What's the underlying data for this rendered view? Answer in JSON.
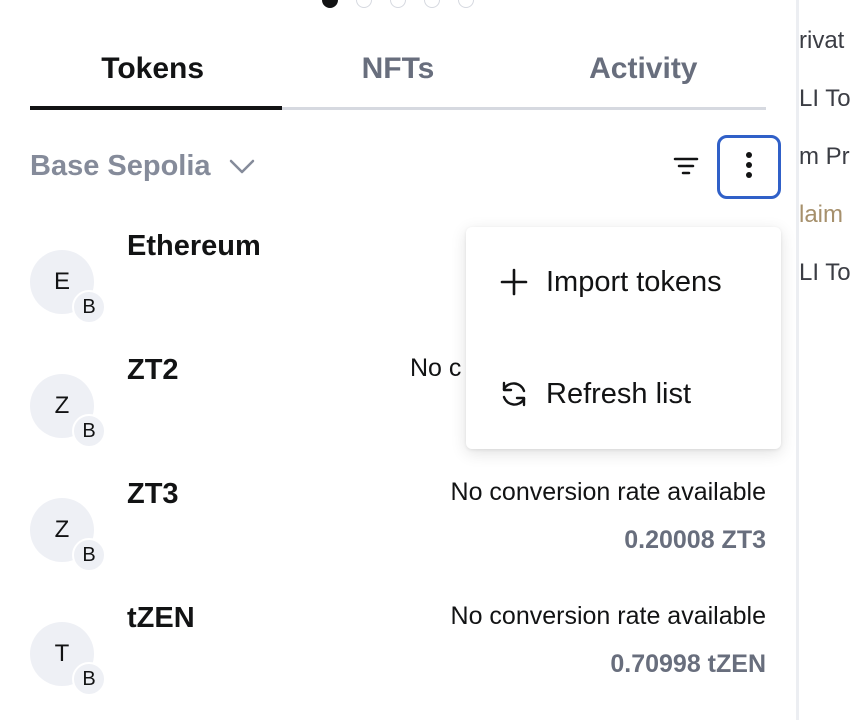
{
  "background_peek": [
    "rivat",
    "LI To",
    "m Pr",
    "laim",
    "LI To"
  ],
  "carousel": {
    "count": 5,
    "active": 0
  },
  "tabs": [
    {
      "label": "Tokens",
      "active": true
    },
    {
      "label": "NFTs",
      "active": false
    },
    {
      "label": "Activity",
      "active": false
    }
  ],
  "network": {
    "label": "Base Sepolia",
    "icon": "chevron-down-icon"
  },
  "toolbar": {
    "filter_icon": "filter-icon",
    "more_icon": "more-vertical-icon"
  },
  "tokens": [
    {
      "avatar": "E",
      "badge": "B",
      "name": "Ethereum",
      "rate": "",
      "balance": ""
    },
    {
      "avatar": "Z",
      "badge": "B",
      "name": "ZT2",
      "rate": "No c",
      "balance": ""
    },
    {
      "avatar": "Z",
      "badge": "B",
      "name": "ZT3",
      "rate": "No conversion rate available",
      "balance": "0.20008 ZT3"
    },
    {
      "avatar": "T",
      "badge": "B",
      "name": "tZEN",
      "rate": "No conversion rate available",
      "balance": "0.70998 tZEN"
    }
  ],
  "menu": {
    "items": [
      {
        "label": "Import tokens",
        "icon": "plus-icon"
      },
      {
        "label": "Refresh list",
        "icon": "refresh-icon"
      }
    ]
  },
  "colors": {
    "accent_border": "#3060c8",
    "text": "#121314",
    "muted": "#686e7d",
    "link": "#a6906c"
  }
}
